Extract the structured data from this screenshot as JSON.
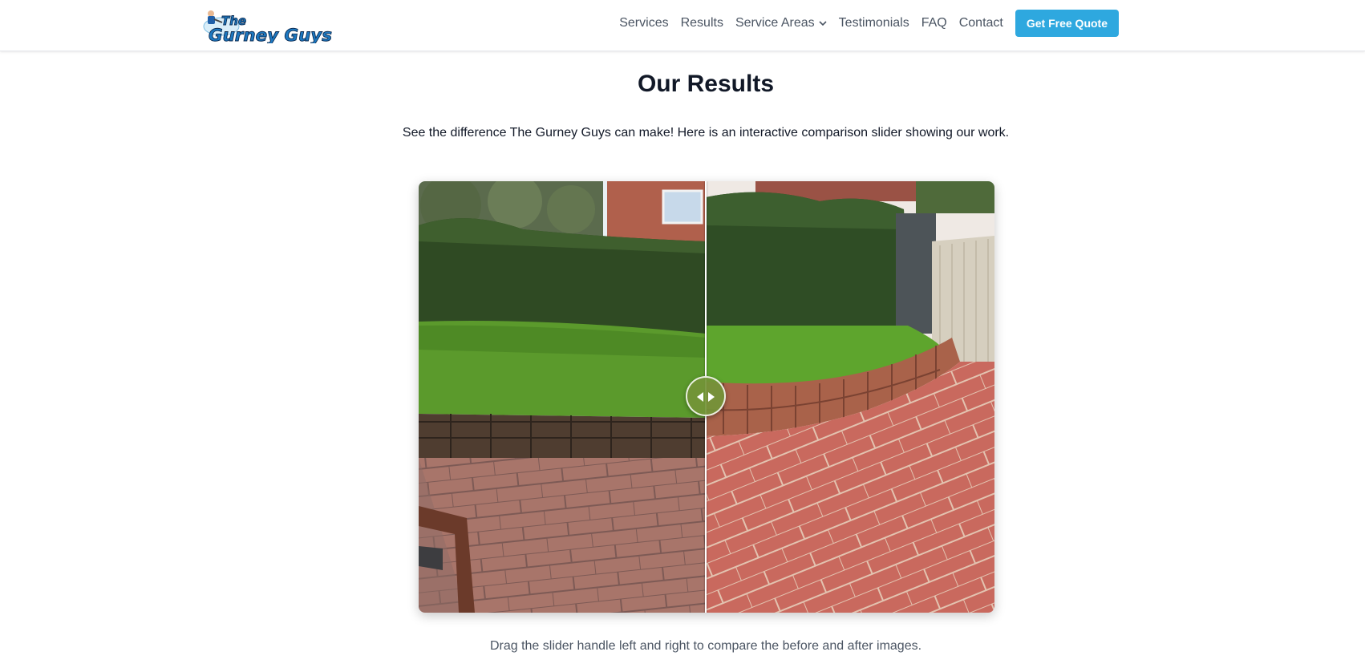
{
  "brand": {
    "logo_line1": "The",
    "logo_line2": "Gurney Guys"
  },
  "nav": {
    "items": [
      "Services",
      "Results",
      "Service Areas",
      "Testimonials",
      "FAQ",
      "Contact"
    ],
    "cta_label": "Get Free Quote",
    "dropdown_icon": "chevron-down-icon"
  },
  "section": {
    "title": "Our Results",
    "subtitle": "See the difference The Gurney Guys can make! Here is an interactive comparison slider showing our work.",
    "caption": "Drag the slider handle left and right to compare the before and after images."
  },
  "slider": {
    "position_percent": 50,
    "handle_icon": "left-right-arrows-icon",
    "before_image": "backyard-before-cleaning",
    "after_image": "backyard-after-cleaning"
  },
  "colors": {
    "accent": "#2ea8df",
    "nav_text": "#4b5563",
    "title": "#111827",
    "handle": "#739437"
  }
}
